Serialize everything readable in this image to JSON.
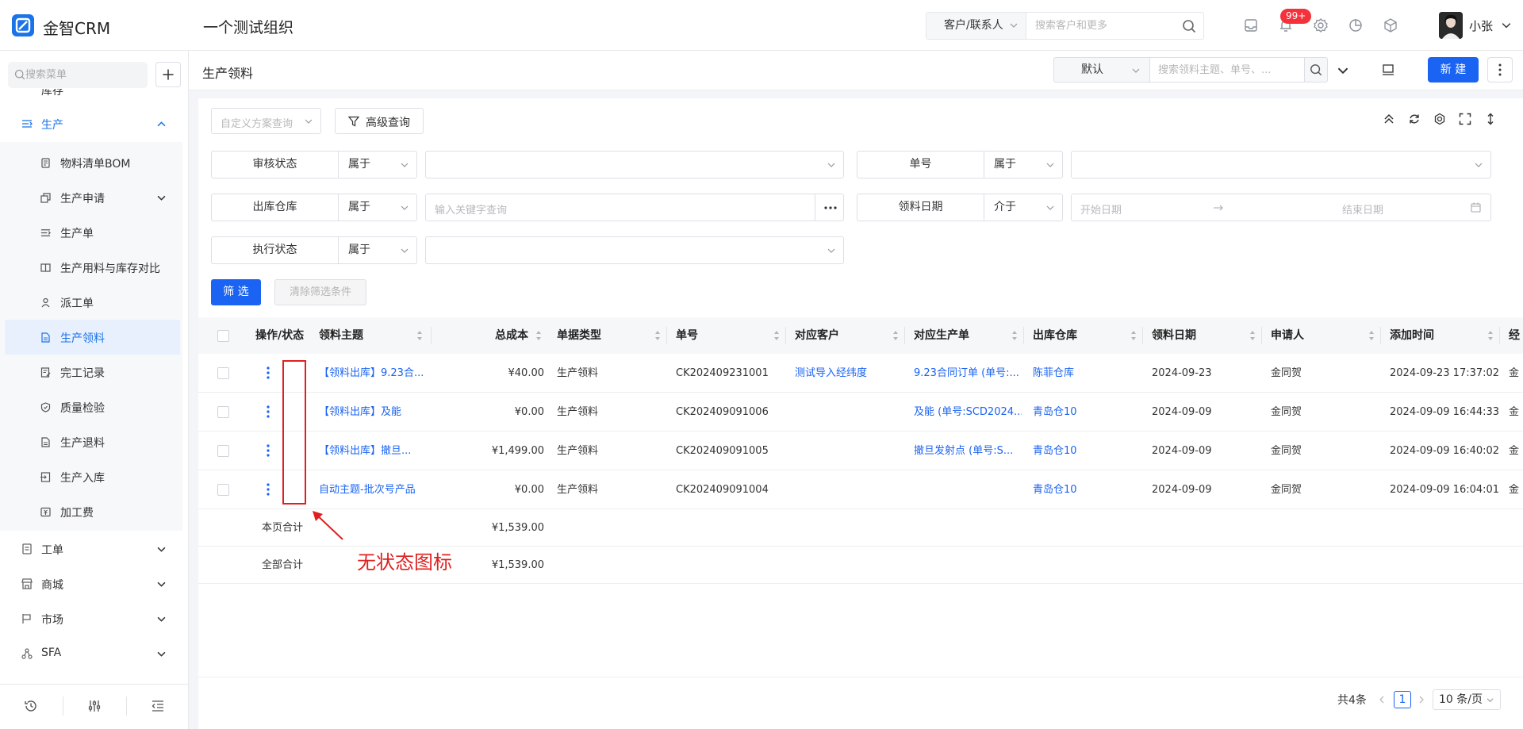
{
  "app": {
    "brand": "金智CRM",
    "org_name": "一个测试组织",
    "user": "小张",
    "notif_badge": "99+"
  },
  "global_search": {
    "type": "客户/联系人",
    "placeholder": "搜索客户和更多"
  },
  "sidebar": {
    "search_placeholder": "搜索菜单",
    "partial_label": "库存",
    "groups": [
      {
        "label": "生产",
        "expanded": true
      },
      {
        "label": "工单"
      },
      {
        "label": "商城"
      },
      {
        "label": "市场"
      },
      {
        "label": "SFA"
      }
    ],
    "production_items": [
      "物料清单BOM",
      "生产申请",
      "生产单",
      "生产用料与库存对比",
      "派工单",
      "生产领料",
      "完工记录",
      "质量检验",
      "生产退料",
      "生产入库",
      "加工费"
    ],
    "active_item": "生产领料"
  },
  "page": {
    "title": "生产领料",
    "view": "默认",
    "search_placeholder": "搜索领料主题、单号、...",
    "new_label": "新 建"
  },
  "filters": {
    "scheme_placeholder": "自定义方案查询",
    "advanced_label": "高级查询",
    "rows": [
      {
        "field": "审核状态",
        "op": "属于"
      },
      {
        "field": "单号",
        "op": "属于"
      },
      {
        "field": "出库仓库",
        "op": "属于",
        "placeholder": "输入关键字查询"
      },
      {
        "field": "领料日期",
        "op": "介于",
        "start": "开始日期",
        "end": "结束日期"
      },
      {
        "field": "执行状态",
        "op": "属于"
      }
    ],
    "filter_btn": "筛 选",
    "clear_btn": "清除筛选条件"
  },
  "table": {
    "columns": [
      "操作/状态",
      "领料主题",
      "总成本",
      "单据类型",
      "单号",
      "对应客户",
      "对应生产单",
      "出库仓库",
      "领料日期",
      "申请人",
      "添加时间",
      "经"
    ],
    "rows": [
      {
        "subject": "【领料出库】9.23合...",
        "cost": "¥40.00",
        "type": "生产领料",
        "no": "CK202409231001",
        "customer": "测试导入经纬度",
        "order": "9.23合同订单 (单号:...",
        "warehouse": "陈菲仓库",
        "date": "2024-09-23",
        "applicant": "金同贺",
        "added": "2024-09-23 17:37:02",
        "extra": "金"
      },
      {
        "subject": "【领料出库】及能",
        "cost": "¥0.00",
        "type": "生产领料",
        "no": "CK202409091006",
        "customer": "",
        "order": "及能 (单号:SCD2024...",
        "warehouse": "青岛仓10",
        "date": "2024-09-09",
        "applicant": "金同贺",
        "added": "2024-09-09 16:44:33",
        "extra": "金"
      },
      {
        "subject": "【领料出库】撤旦...",
        "cost": "¥1,499.00",
        "type": "生产领料",
        "no": "CK202409091005",
        "customer": "",
        "order": "撤旦发射点 (单号:S...",
        "warehouse": "青岛仓10",
        "date": "2024-09-09",
        "applicant": "金同贺",
        "added": "2024-09-09 16:40:02",
        "extra": "金"
      },
      {
        "subject": "自动主题-批次号产品",
        "cost": "¥0.00",
        "type": "生产领料",
        "no": "CK202409091004",
        "customer": "",
        "order": "",
        "warehouse": "青岛仓10",
        "date": "2024-09-09",
        "applicant": "金同贺",
        "added": "2024-09-09 16:04:01",
        "extra": "金"
      }
    ],
    "page_total_label": "本页合计",
    "page_total": "¥1,539.00",
    "all_total_label": "全部合计",
    "all_total": "¥1,539.00"
  },
  "annotation": "无状态图标",
  "pagination": {
    "total": "共4条",
    "current": "1",
    "page_size": "10 条/页"
  },
  "colors": {
    "primary": "#1a63f3",
    "annotation": "#e02020",
    "badge": "#f5313b"
  }
}
